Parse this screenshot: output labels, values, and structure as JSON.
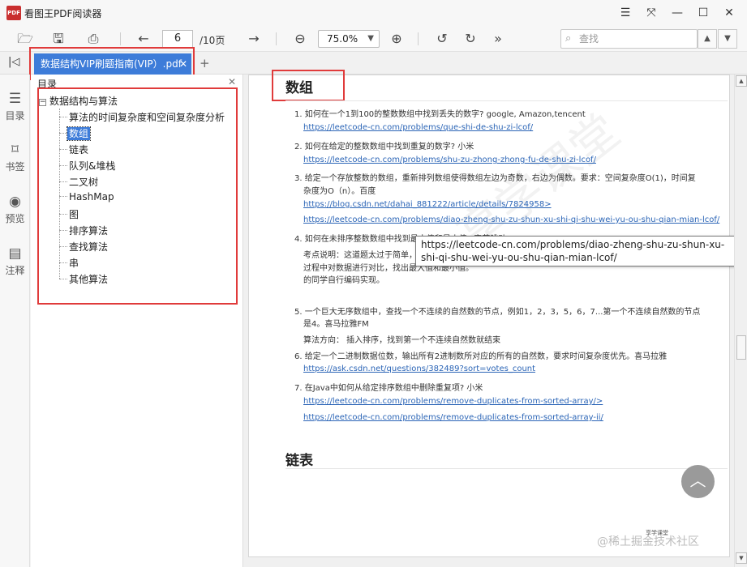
{
  "app": {
    "title": "看图王PDF阅读器",
    "logo_text": "PDF"
  },
  "window_controls": [
    "minimize-menu",
    "fullscreen",
    "minimize",
    "maximize",
    "close"
  ],
  "toolbar": {
    "page_current": "6",
    "page_total": "/10页",
    "zoom": "75.0%",
    "search_placeholder": "查找"
  },
  "tabs": [
    {
      "label": "数据结构VIP刷题指南(VIP）.pdf",
      "active": true
    }
  ],
  "rail": [
    {
      "label": "目录",
      "icon": "list-icon"
    },
    {
      "label": "书签",
      "icon": "bookmark-icon"
    },
    {
      "label": "预览",
      "icon": "eye-icon"
    },
    {
      "label": "注释",
      "icon": "comment-icon"
    }
  ],
  "sidebar": {
    "title": "目录",
    "root": "数据结构与算法",
    "items": [
      {
        "label": "算法的时间复杂度和空间复杂度分析",
        "selected": false
      },
      {
        "label": "数组",
        "selected": true
      },
      {
        "label": "链表",
        "selected": false
      },
      {
        "label": "队列&堆栈",
        "selected": false
      },
      {
        "label": "二叉树",
        "selected": false
      },
      {
        "label": "HashMap",
        "selected": false
      },
      {
        "label": "图",
        "selected": false
      },
      {
        "label": "排序算法",
        "selected": false
      },
      {
        "label": "查找算法",
        "selected": false
      },
      {
        "label": "串",
        "selected": false
      },
      {
        "label": "其他算法",
        "selected": false
      }
    ]
  },
  "document": {
    "section_title": "数组",
    "next_section": "链表",
    "lines": [
      {
        "text": "1. 如何在一个1到100的整数数组中找到丢失的数字? google, Amazon,tencent",
        "kind": "item"
      },
      {
        "text": "https://leetcode-cn.com/problems/que-shi-de-shu-zi-lcof/",
        "kind": "link"
      },
      {
        "text": "2. 如何在给定的整数数组中找到重复的数字? 小米",
        "kind": "item"
      },
      {
        "text": "https://leetcode-cn.com/problems/shu-zu-zhong-zhong-fu-de-shu-zi-lcof/",
        "kind": "link"
      },
      {
        "text": "3. 给定一个存放整数的数组，重新排列数组使得数组左边为奇数，右边为偶数。要求：空间复杂度O(1)，时间复",
        "kind": "item"
      },
      {
        "text": "杂度为O（n）。百度",
        "kind": "cont"
      },
      {
        "text": "https://blog.csdn.net/dahai_881222/article/details/7824958>",
        "kind": "link"
      },
      {
        "text": "https://leetcode-cn.com/problems/diao-zheng-shu-zu-shun-xu-shi-qi-shu-wei-yu-ou-shu-qian-mian-lcof/",
        "kind": "link"
      },
      {
        "text": "4. 如何在未排序整数数组中找到最大值和最小值? 字节跳动",
        "kind": "item"
      },
      {
        "text": "考点说明：这道题太过于简单，",
        "kind": "cont"
      },
      {
        "text": "过程中对数据进行对比，找出最大值和最小值。",
        "kind": "cont"
      },
      {
        "text": "的同学自行编码实现。",
        "kind": "cont"
      },
      {
        "text": "5. 一个巨大无序数组中，查找一个不连续的自然数的节点，例如1，2，3，5，6，7...第一个不连续自然数的节点",
        "kind": "item"
      },
      {
        "text": "是4。喜马拉雅FM",
        "kind": "cont"
      },
      {
        "text": "算法方向：  插入排序，找到第一个不连续自然数就结束",
        "kind": "cont"
      },
      {
        "text": "6. 给定一个二进制数据位数，输出所有2进制数所对应的所有的自然数，要求时间复杂度优先。喜马拉雅",
        "kind": "item"
      },
      {
        "text": "https://ask.csdn.net/questions/382489?sort=votes_count",
        "kind": "link"
      },
      {
        "text": "7. 在Java中如何从给定排序数组中删除重复项? 小米",
        "kind": "item"
      },
      {
        "text": "https://leetcode-cn.com/problems/remove-duplicates-from-sorted-array/>",
        "kind": "link"
      },
      {
        "text": "https://leetcode-cn.com/problems/remove-duplicates-from-sorted-array-ii/",
        "kind": "link"
      }
    ],
    "tooltip": "https://leetcode-cn.com/problems/diao-zheng-shu-zu-shun-xu-shi-qi-shu-wei-yu-ou-shu-qian-mian-lcof/",
    "watermark": "享学课堂",
    "footer_mark": "享学课堂",
    "brand": "@稀土掘金技术社区"
  },
  "colors": {
    "accent": "#3d7cd9",
    "highlight": "#e03b3b",
    "link": "#2a64b6"
  }
}
